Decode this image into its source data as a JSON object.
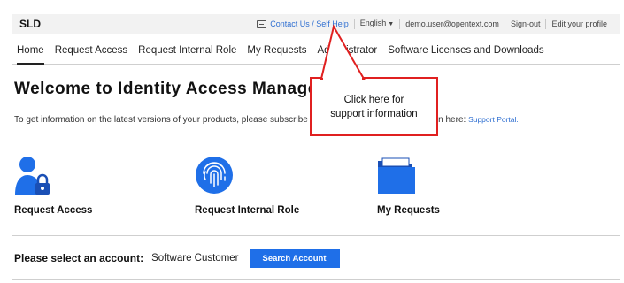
{
  "header": {
    "brand": "SLD",
    "contact_label": "Contact Us / Self Help",
    "language_label": "English",
    "user_email": "demo.user@opentext.com",
    "signout_label": "Sign-out",
    "edit_profile_label": "Edit your profile"
  },
  "nav": {
    "items": [
      {
        "label": "Home",
        "active": true
      },
      {
        "label": "Request Access"
      },
      {
        "label": "Request Internal Role"
      },
      {
        "label": "My Requests"
      },
      {
        "label": "Administrator"
      },
      {
        "label": "Software Licenses and Downloads"
      }
    ]
  },
  "main": {
    "title": "Welcome to Identity Access Management",
    "info_text": "To get information on the latest versions of your products, please subscribe to the product lifecycle notification here:",
    "portal_link": "Support Portal.",
    "tiles": [
      {
        "label": "Request Access",
        "icon": "user-lock-icon"
      },
      {
        "label": "Request Internal Role",
        "icon": "fingerprint-icon"
      },
      {
        "label": "My Requests",
        "icon": "folder-icon"
      }
    ],
    "account_label": "Please select an account:",
    "account_value": "Software Customer",
    "search_button": "Search Account"
  },
  "callout": {
    "line1": "Click here for",
    "line2": "support information"
  },
  "colors": {
    "accent": "#1f6fe8",
    "link": "#2f6fd1",
    "callout_border": "#e02020"
  }
}
